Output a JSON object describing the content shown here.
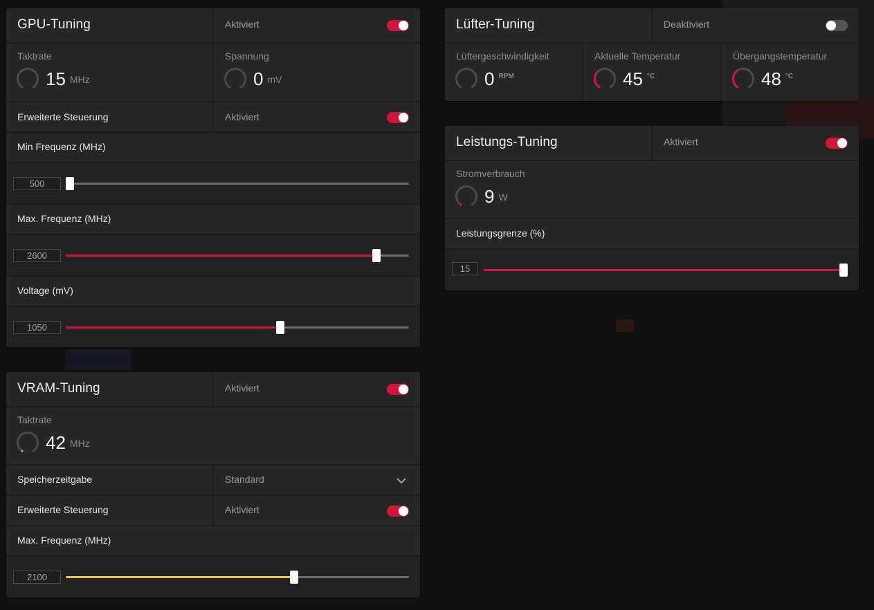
{
  "colors": {
    "accent": "#d4153a",
    "vram_accent": "#f2c14a",
    "panel": "#262627"
  },
  "gpu": {
    "title": "GPU-Tuning",
    "state": "Aktiviert",
    "toggle_on": true,
    "clock": {
      "label": "Taktrate",
      "value": "15",
      "unit": "MHz",
      "gauge": 0.0
    },
    "voltage": {
      "label": "Spannung",
      "value": "0",
      "unit": "mV",
      "gauge": 0.0
    },
    "advanced": {
      "label": "Erweiterte Steuerung",
      "state": "Aktiviert",
      "toggle_on": true
    },
    "min_freq": {
      "label": "Min Frequenz (MHz)",
      "value": "500",
      "fraction": 0.0
    },
    "max_freq": {
      "label": "Max. Frequenz (MHz)",
      "value": "2600",
      "fraction": 0.905
    },
    "voltage_slider": {
      "label": "Voltage (mV)",
      "value": "1050",
      "fraction": 0.626
    }
  },
  "vram": {
    "title": "VRAM-Tuning",
    "state": "Aktiviert",
    "toggle_on": true,
    "clock": {
      "label": "Taktrate",
      "value": "42",
      "unit": "MHz",
      "gauge": 0.03
    },
    "timing": {
      "label": "Speicherzeitgabe",
      "value": "Standard"
    },
    "advanced": {
      "label": "Erweiterte Steuerung",
      "state": "Aktiviert",
      "toggle_on": true
    },
    "max_freq": {
      "label": "Max. Frequenz (MHz)",
      "value": "2100",
      "fraction": 0.665
    }
  },
  "fan": {
    "title": "Lüfter-Tuning",
    "state": "Deaktiviert",
    "toggle_on": false,
    "speed": {
      "label": "Lüftergeschwindigkeit",
      "value": "0",
      "unit": "RPM",
      "gauge": 0.0
    },
    "temp": {
      "label": "Aktuelle Temperatur",
      "value": "45",
      "unit": "°C",
      "gauge": 0.35
    },
    "junction": {
      "label": "Übergangstemperatur",
      "value": "48",
      "unit": "°C",
      "gauge": 0.37
    }
  },
  "power": {
    "title": "Leistungs-Tuning",
    "state": "Aktiviert",
    "toggle_on": true,
    "usage": {
      "label": "Stromverbrauch",
      "value": "9",
      "unit": "W",
      "gauge": 0.04
    },
    "limit": {
      "label": "Leistungsgrenze (%)",
      "value": "15",
      "fraction": 1.0
    }
  }
}
